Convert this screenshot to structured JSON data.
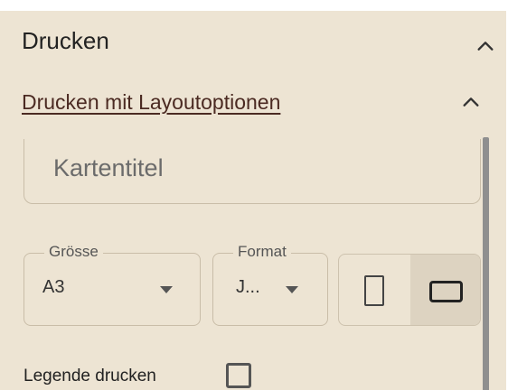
{
  "print": {
    "title": "Drucken",
    "collapse_icon": "chevron-up-icon",
    "layout_options": {
      "title": "Drucken mit Layoutoptionen",
      "collapse_icon": "chevron-up-icon",
      "map_title": {
        "value": "",
        "placeholder": "Kartentitel"
      },
      "size": {
        "label": "Grösse",
        "value": "A3"
      },
      "format": {
        "label": "Format",
        "value": "J..."
      },
      "orientation": {
        "options": [
          "portrait-icon",
          "landscape-icon"
        ],
        "selected": "landscape"
      },
      "print_legend": {
        "label": "Legende drucken",
        "checked": false
      }
    }
  },
  "colors": {
    "panel_background": "#ede4d3",
    "link_text": "#4b2a22",
    "selected_toggle": "#ddd3c1",
    "border": "#c9bda8"
  }
}
